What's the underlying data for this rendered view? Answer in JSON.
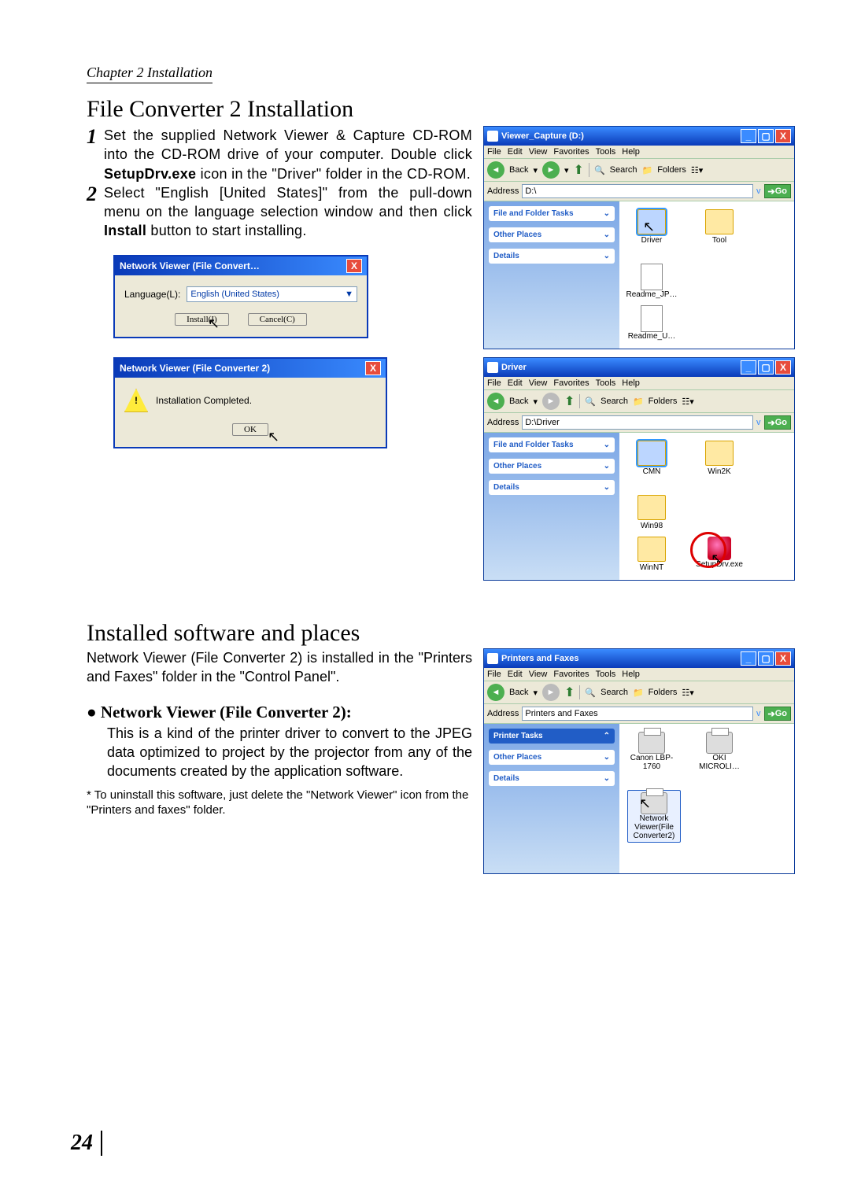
{
  "page": {
    "chapter": "Chapter 2 Installation",
    "number": "24"
  },
  "section1": {
    "title": "File Converter 2 Installation",
    "step1_num": "1",
    "step1": "Set the supplied Network Viewer & Capture CD-ROM into the CD-ROM drive of your computer. Double click ",
    "step1_bold": "SetupDrv.exe",
    "step1_tail": " icon in the \"Driver\" folder in the CD-ROM.",
    "step2_num": "2",
    "step2": "Select \"English [United States]\" from the pull-down menu on the language selection window and then click ",
    "step2_bold": "Install",
    "step2_tail": " button to start installing."
  },
  "dialog1": {
    "title": "Network Viewer (File Convert…",
    "label": "Language(L):",
    "language": "English (United States)",
    "install": "Install(I)",
    "cancel": "Cancel(C)"
  },
  "dialog2": {
    "title": "Network Viewer (File Converter 2)",
    "message": "Installation Completed.",
    "ok": "OK"
  },
  "section2": {
    "title": "Installed software and places",
    "desc": "Network Viewer (File Converter 2) is installed in the \"Printers and Faxes\" folder in the \"Control Panel\".",
    "bullet": "● Network Viewer (File Converter 2):",
    "bullet_body": "This is a kind of the printer driver to convert to the JPEG data optimized to project by the projector from any of the documents created by the application software.",
    "footnote": "* To uninstall this software, just delete the \"Network Viewer\" icon from the \"Printers and faxes\" folder."
  },
  "explorer": {
    "menu": {
      "file": "File",
      "edit": "Edit",
      "view": "View",
      "fav": "Favorites",
      "tools": "Tools",
      "help": "Help"
    },
    "toolbar": {
      "back": "Back",
      "search": "Search",
      "folders": "Folders"
    },
    "addr_label": "Address",
    "go": "Go",
    "side": {
      "file_tasks": "File and Folder Tasks",
      "other_places": "Other Places",
      "details": "Details",
      "printer_tasks": "Printer Tasks"
    }
  },
  "win1": {
    "title": "Viewer_Capture (D:)",
    "addr": "D:\\",
    "items": [
      "Driver",
      "Tool",
      "Readme_JP…",
      "Readme_U…"
    ]
  },
  "win2": {
    "title": "Driver",
    "addr": "D:\\Driver",
    "items": [
      "CMN",
      "Win2K",
      "Win98",
      "WinNT",
      "SetupDrv.exe"
    ]
  },
  "win3": {
    "title": "Printers and Faxes",
    "addr": "Printers and Faxes",
    "items": [
      "Canon LBP-1760",
      "OKI MICROLI…",
      "Network Viewer(File Converter2)"
    ]
  }
}
